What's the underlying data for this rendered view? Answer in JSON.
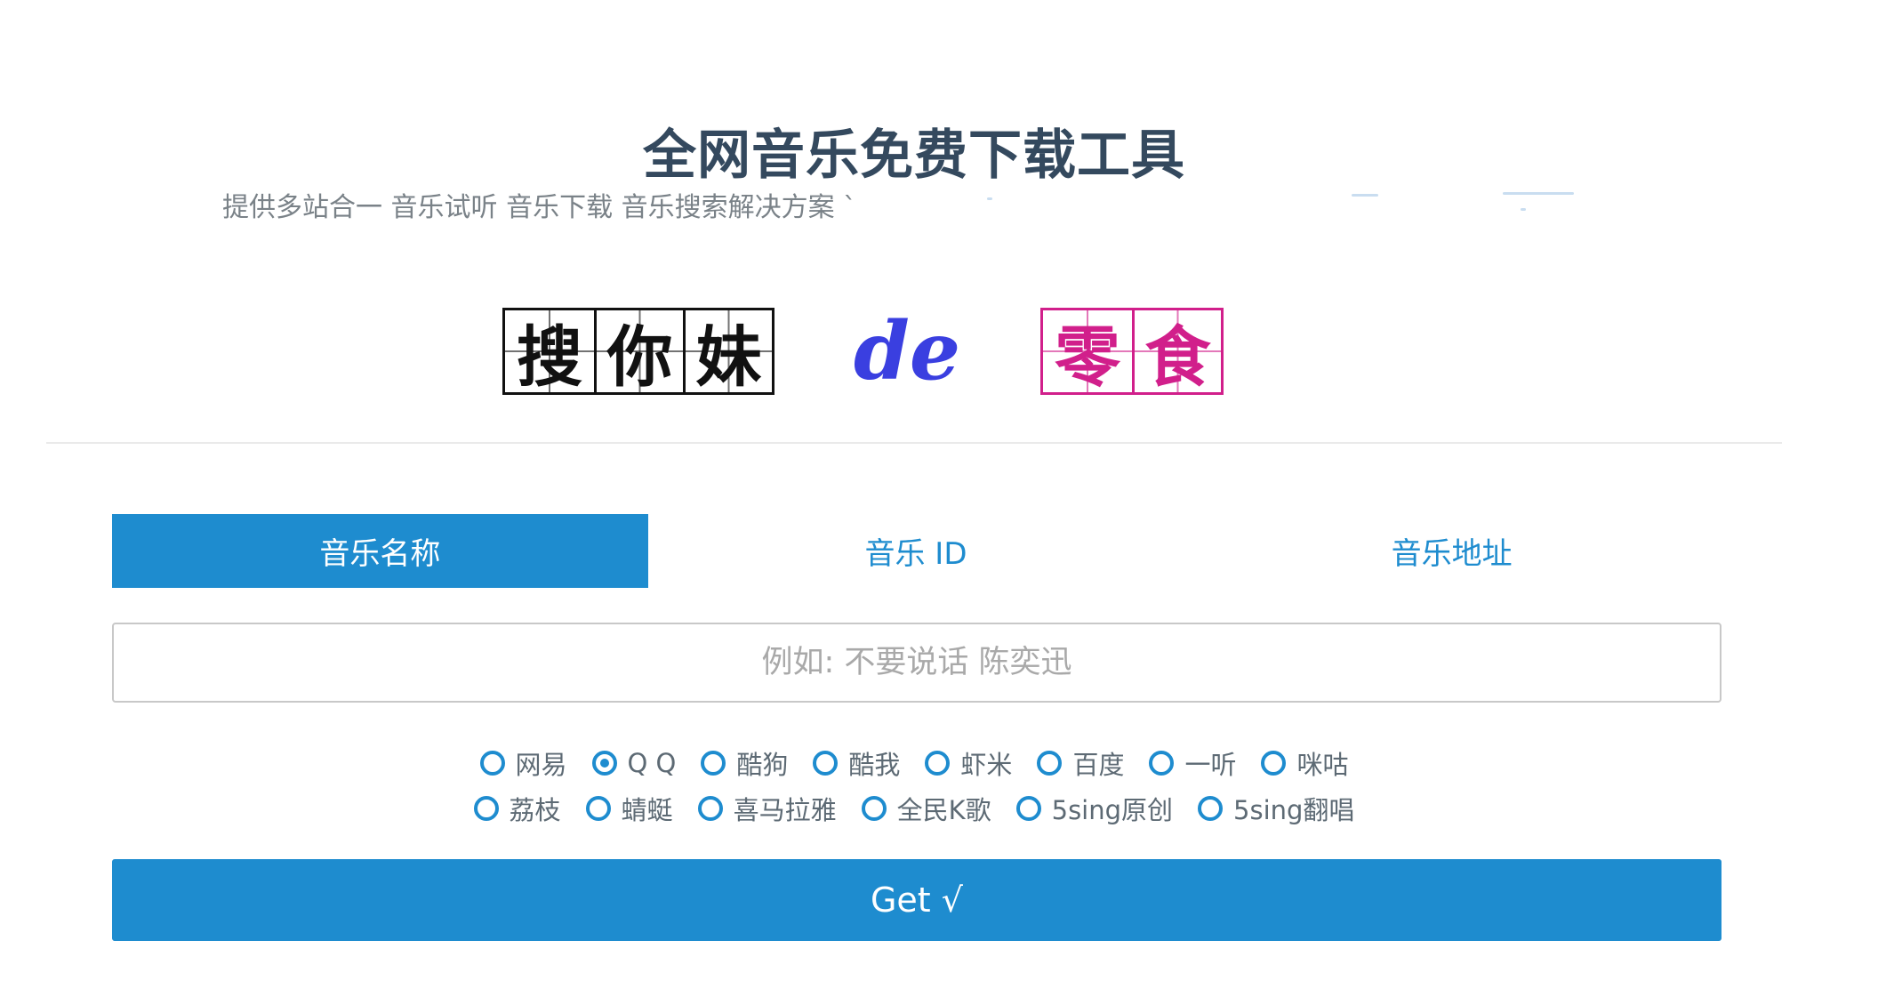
{
  "header": {
    "title": "全网音乐免费下载工具",
    "subtitle": "提供多站合一 音乐试听 音乐下载 音乐搜索解决方案 `"
  },
  "logo": {
    "part1_chars": [
      "搜",
      "你",
      "妹"
    ],
    "part2": "de",
    "part3_chars": [
      "零",
      "食"
    ]
  },
  "tabs": [
    {
      "label": "音乐名称",
      "active": true
    },
    {
      "label": "音乐 ID",
      "active": false
    },
    {
      "label": "音乐地址",
      "active": false
    }
  ],
  "search": {
    "placeholder": "例如: 不要说话 陈奕迅",
    "value": ""
  },
  "sources_row1": [
    {
      "label": "网易",
      "checked": false
    },
    {
      "label": "Q Q",
      "checked": true
    },
    {
      "label": "酷狗",
      "checked": false
    },
    {
      "label": "酷我",
      "checked": false
    },
    {
      "label": "虾米",
      "checked": false
    },
    {
      "label": "百度",
      "checked": false
    },
    {
      "label": "一听",
      "checked": false
    },
    {
      "label": "咪咕",
      "checked": false
    }
  ],
  "sources_row2": [
    {
      "label": "荔枝",
      "checked": false
    },
    {
      "label": "蜻蜓",
      "checked": false
    },
    {
      "label": "喜马拉雅",
      "checked": false
    },
    {
      "label": "全民K歌",
      "checked": false
    },
    {
      "label": "5sing原创",
      "checked": false
    },
    {
      "label": "5sing翻唱",
      "checked": false
    }
  ],
  "submit": {
    "label": "Get √"
  },
  "colors": {
    "accent": "#1e8ccf",
    "title": "#34495e",
    "logo_pink": "#d11f8b",
    "logo_blue": "#3a3fe0"
  }
}
